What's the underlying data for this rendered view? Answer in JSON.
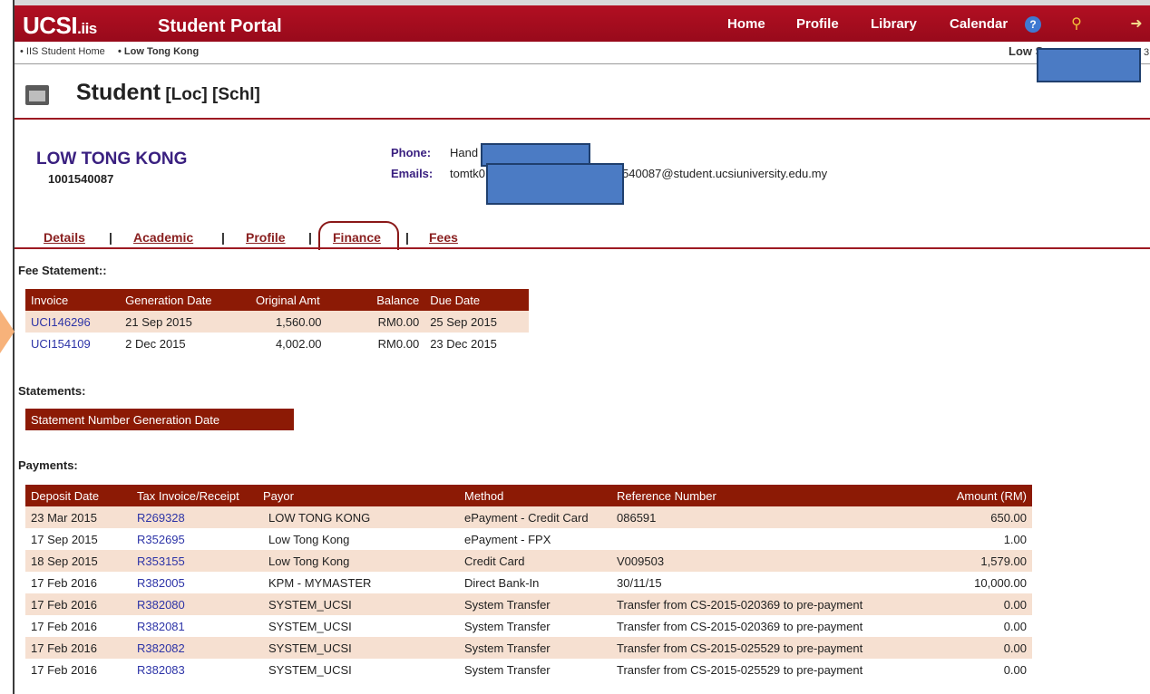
{
  "header": {
    "logo": "UCSI",
    "logo_suffix": ".iis",
    "title": "Student Portal",
    "nav": [
      "Home",
      "Profile",
      "Library",
      "Calendar"
    ],
    "accent_color": "#a50d1e"
  },
  "breadcrumb": {
    "item1": "• IIS Student Home",
    "item2": "• Low Tong Kong",
    "user_visible": "Low Se",
    "user_tail": "3"
  },
  "page": {
    "title": "Student",
    "subtitle": " [Loc] [Schl]"
  },
  "student": {
    "name": "LOW TONG KONG",
    "id": "1001540087",
    "phone_label": "Phone:",
    "phone_value": "Hand",
    "emails_label": "Emails:",
    "email_prefix": "tomtk0",
    "email_suffix": "540087@student.ucsiuniversity.edu.my"
  },
  "tabs": [
    {
      "label": "Details"
    },
    {
      "label": "Academic"
    },
    {
      "label": "Profile"
    },
    {
      "label": "Finance",
      "active": true
    },
    {
      "label": "Fees"
    }
  ],
  "fee_statement": {
    "label": "Fee Statement::",
    "headers": [
      "Invoice",
      "Generation Date",
      "Original Amt",
      "Balance",
      "Due Date"
    ],
    "rows": [
      [
        "UCI146296",
        "21 Sep 2015",
        "1,560.00",
        "RM0.00",
        "25 Sep 2015"
      ],
      [
        "UCI154109",
        "2 Dec 2015",
        "4,002.00",
        "RM0.00",
        "23 Dec 2015"
      ]
    ]
  },
  "statements": {
    "label": "Statements:",
    "header": "Statement Number Generation Date"
  },
  "payments": {
    "label": "Payments:",
    "headers": [
      "Deposit Date",
      "Tax Invoice/Receipt",
      "Payor",
      "Method",
      "Reference Number",
      "Amount (RM)"
    ],
    "rows": [
      [
        "23 Mar 2015",
        "R269328",
        "LOW TONG KONG",
        "ePayment - Credit Card",
        "086591",
        "650.00"
      ],
      [
        "17 Sep 2015",
        "R352695",
        "Low Tong Kong",
        "ePayment - FPX",
        "",
        "1.00"
      ],
      [
        "18 Sep 2015",
        "R353155",
        "Low Tong Kong",
        "Credit Card",
        "V009503",
        "1,579.00"
      ],
      [
        "17 Feb 2016",
        "R382005",
        "KPM - MYMASTER",
        "Direct Bank-In",
        "30/11/15",
        "10,000.00"
      ],
      [
        "17 Feb 2016",
        "R382080",
        "SYSTEM_UCSI",
        "System Transfer",
        "Transfer from CS-2015-020369 to pre-payment",
        "0.00"
      ],
      [
        "17 Feb 2016",
        "R382081",
        "SYSTEM_UCSI",
        "System Transfer",
        "Transfer from CS-2015-020369 to pre-payment",
        "0.00"
      ],
      [
        "17 Feb 2016",
        "R382082",
        "SYSTEM_UCSI",
        "System Transfer",
        "Transfer from CS-2015-025529 to pre-payment",
        "0.00"
      ],
      [
        "17 Feb 2016",
        "R382083",
        "SYSTEM_UCSI",
        "System Transfer",
        "Transfer from CS-2015-025529 to pre-payment",
        "0.00"
      ]
    ]
  },
  "icons": {
    "help": "help-icon",
    "key": "key-icon",
    "logout": "logout-icon",
    "student": "student-icon"
  }
}
